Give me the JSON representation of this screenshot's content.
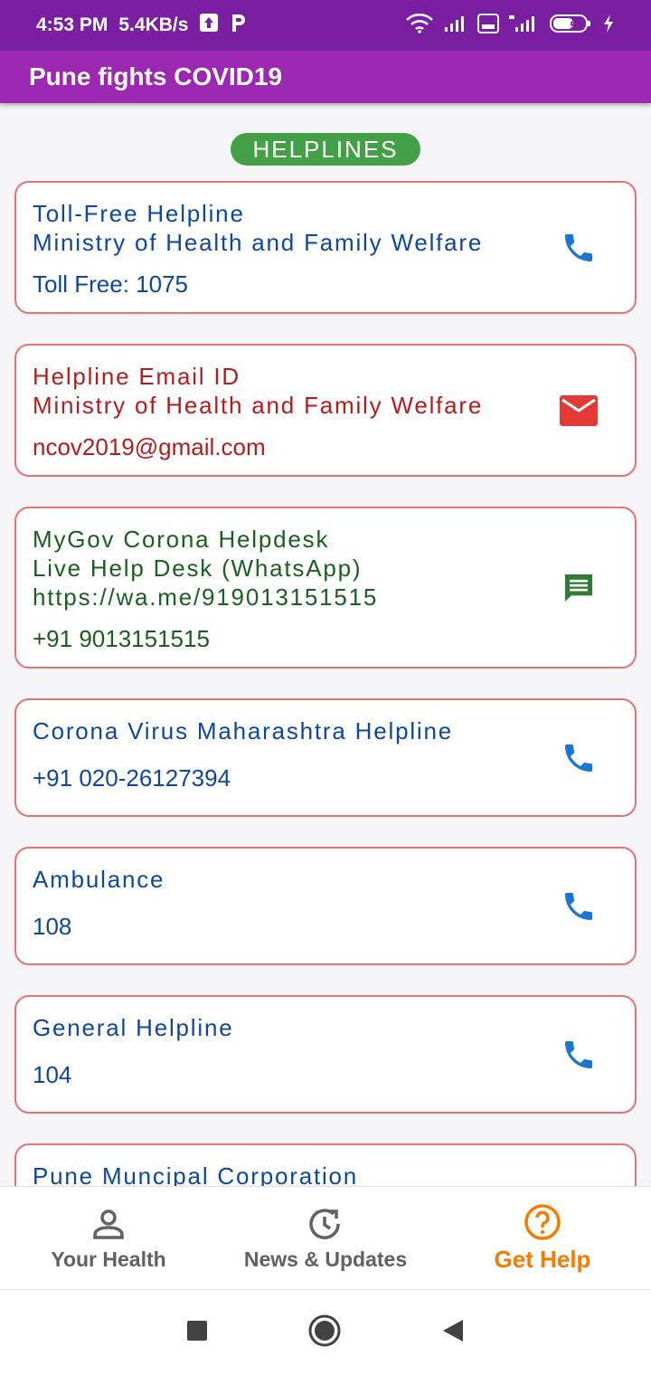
{
  "status_bar": {
    "time": "4:53 PM",
    "speed": "5.4KB/s",
    "battery": "51"
  },
  "app_bar": {
    "title": "Pune fights COVID19"
  },
  "section": {
    "label": "HELPLINES"
  },
  "cards": [
    {
      "line1": "Toll-Free Helpline",
      "line2": "Ministry of Health and Family Welfare",
      "value": "Toll Free: 1075",
      "icon": "phone-icon",
      "color": "#0d47a1"
    },
    {
      "line1": "Helpline Email ID",
      "line2": "Ministry of Health and Family Welfare",
      "value": "ncov2019@gmail.com",
      "icon": "email-icon",
      "color": "#b71c1c"
    },
    {
      "line1": "MyGov Corona Helpdesk",
      "line2": "Live Help Desk (WhatsApp)",
      "line3": "https://wa.me/919013151515",
      "value": "+91 9013151515",
      "icon": "chat-icon",
      "color": "#1b5e20"
    },
    {
      "line1": "Corona Virus Maharashtra Helpline",
      "value": "+91 020-26127394",
      "icon": "phone-icon",
      "color": "#0d47a1"
    },
    {
      "line1": "Ambulance",
      "value": "108",
      "icon": "phone-icon",
      "color": "#0d47a1"
    },
    {
      "line1": "General Helpline",
      "value": "104",
      "icon": "phone-icon",
      "color": "#0d47a1"
    },
    {
      "line1": "Pune Muncipal Corporation",
      "icon": "phone-icon",
      "color": "#0d47a1"
    }
  ],
  "bottom_nav": {
    "items": [
      {
        "label": "Your Health",
        "icon": "person-icon"
      },
      {
        "label": "News & Updates",
        "icon": "history-icon"
      },
      {
        "label": "Get Help",
        "icon": "help-icon",
        "active": true
      }
    ],
    "active_color": "#f57c00"
  },
  "system_nav": {
    "buttons": [
      "recents",
      "home",
      "back"
    ]
  }
}
